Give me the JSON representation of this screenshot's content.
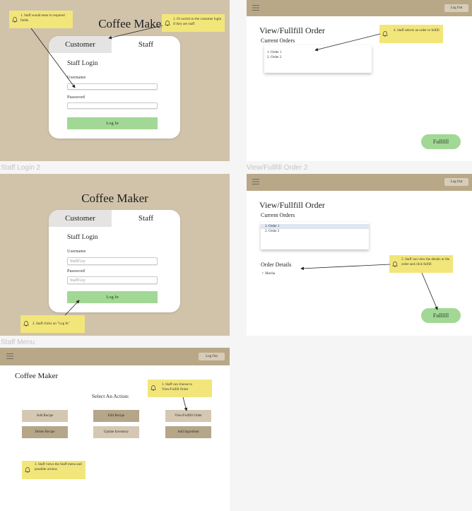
{
  "staff_login_1": {
    "app_title": "Coffee Maker",
    "tabs": [
      "Customer",
      "Staff"
    ],
    "heading": "Staff Login",
    "username_label": "Username",
    "password_label": "Password",
    "login_button": "Log In",
    "note_1": "1. Staff would enter in required fields",
    "note_2": "1. Or switch to the customer login if they are staff"
  },
  "view_fullfill_order_1": {
    "logout": "Log Out",
    "title": "View/Fullfill Order",
    "current_orders": "Current Orders",
    "orders": [
      "1. Order 1",
      "2. Order 2"
    ],
    "fullfill_button": "Fullfill",
    "note": "4. Staff selects an order to fulfill"
  },
  "staff_login_2": {
    "frame_label": "Staff Login 2",
    "app_title": "Coffee Maker",
    "tabs": [
      "Customer",
      "Staff"
    ],
    "heading": "Staff Login",
    "username_label": "Username",
    "username_value": "StaffGuy",
    "password_label": "Password",
    "password_value": "StaffGuy",
    "login_button": "Log In",
    "note": "2. Staff clicks on \"Log In\""
  },
  "view_fullfill_order_2": {
    "frame_label": "View/Fullfill Order 2",
    "logout": "Log Out",
    "title": "View/Fullfill Order",
    "current_orders": "Current Orders",
    "orders": [
      "1. Order 1",
      "2. Order 2"
    ],
    "order_details": "Order Details",
    "details_items": [
      "Mocha"
    ],
    "fullfill_button": "Fullfill",
    "note": "5. Staff can view the details or the order and click fulfill"
  },
  "staff_menu": {
    "frame_label": "Staff Menu",
    "logout": "Log Out",
    "app_title": "Coffee Maker",
    "prompt": "Select An Action:",
    "buttons": {
      "add_recipe": "Add Recipe",
      "edit_recipe": "Edit Recipe",
      "view_fullfill": "View/Fullfill Order",
      "delete_recipe": "Delete Recipe",
      "update_inventory": "Update Inventory",
      "add_ingredient": "Add Ingredient"
    },
    "note_3": "3. Staff can choose to View/Fulfill Order",
    "note_views": "3. Staff views the Staff menu and possible actions"
  },
  "colors": {
    "tan_background": "#d0c3aa",
    "top_bar": "#b8a888",
    "green_button": "#a2d895",
    "sticky_note": "#f2e67b"
  }
}
